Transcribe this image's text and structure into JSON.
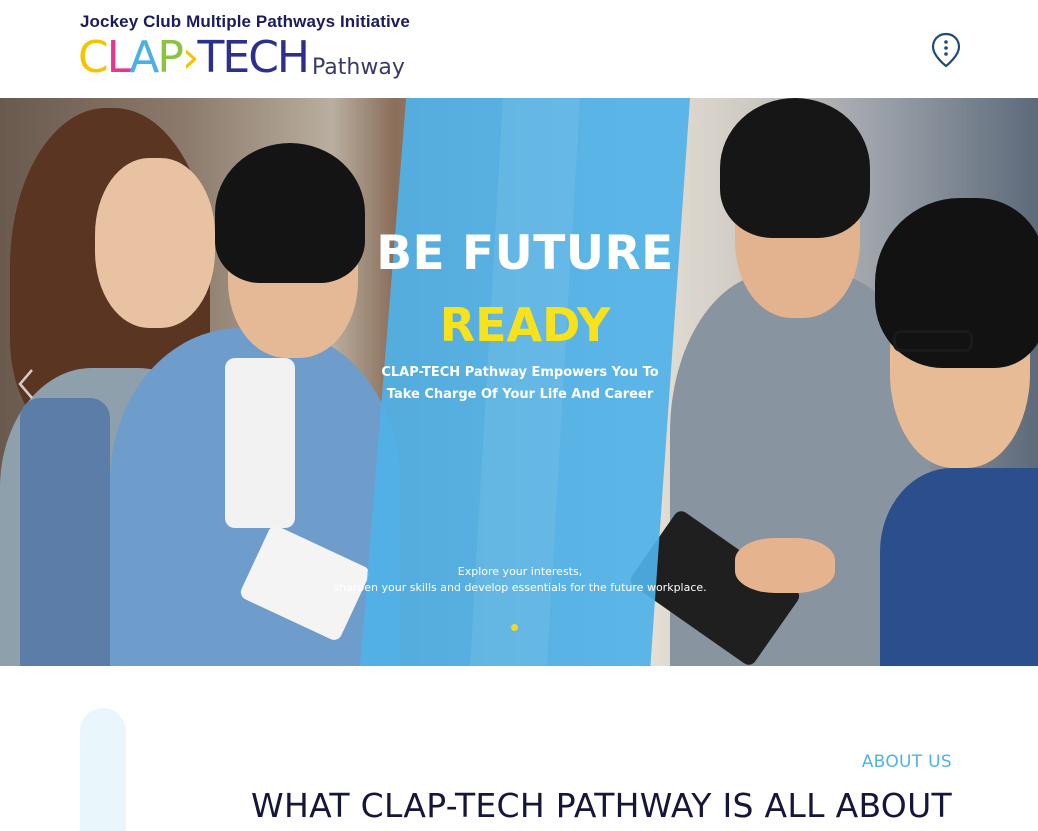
{
  "header": {
    "org_title": "Jockey Club Multiple Pathways Initiative",
    "logo": {
      "letters": [
        "C",
        "L",
        "A",
        "P",
        "›",
        "TECH"
      ],
      "sub": "Pathway"
    },
    "menu_icon": "map-pin-menu-icon"
  },
  "hero": {
    "title_line1": "BE FUTURE",
    "title_line2": "READY",
    "subtitle_line1": "CLAP-TECH Pathway Empowers You To",
    "subtitle_line2": "Take Charge Of Your Life And Career",
    "desc_line1": "Explore your interests,",
    "desc_line2": "sharpen your skills and develop essentials for the future workplace.",
    "prev_icon": "chevron-left-icon",
    "slide_count": 1,
    "active_slide": 1
  },
  "about": {
    "kicker": "ABOUT US",
    "heading": "WHAT CLAP-TECH PATHWAY IS ALL ABOUT"
  },
  "colors": {
    "panel_blue": "#4fb2e8",
    "accent_yellow": "#f8e21c",
    "kicker_blue": "#4db4e4",
    "heading_navy": "#16163a"
  }
}
